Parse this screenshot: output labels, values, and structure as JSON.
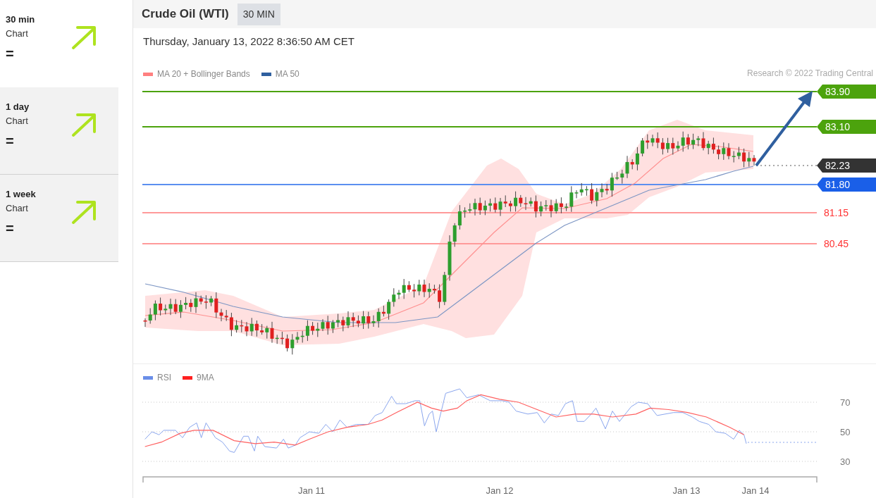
{
  "sidebar": {
    "items": [
      {
        "timeframe": "30 min",
        "label": "Chart",
        "trend_text": "=",
        "selected": true
      },
      {
        "timeframe": "1 day",
        "label": "Chart",
        "trend_text": "=",
        "selected": false
      },
      {
        "timeframe": "1 week",
        "label": "Chart",
        "trend_text": "=",
        "selected": false
      }
    ]
  },
  "header": {
    "title": "Crude Oil (WTI)",
    "timeframe_badge": "30 MIN"
  },
  "timestamp": "Thursday, January 13, 2022 8:36:50 AM CET",
  "price_chart": {
    "legend": [
      {
        "label": "MA 20 + Bollinger Bands",
        "color": "#ff8080"
      },
      {
        "label": "MA 50",
        "color": "#2f5f9f"
      }
    ],
    "credit": "Research © 2022 Trading Central",
    "levels": [
      {
        "value": "83.90",
        "kind": "resistance"
      },
      {
        "value": "83.10",
        "kind": "resistance"
      },
      {
        "value": "82.23",
        "kind": "current"
      },
      {
        "value": "81.80",
        "kind": "pivot"
      },
      {
        "value": "81.15",
        "kind": "support"
      },
      {
        "value": "80.45",
        "kind": "support"
      }
    ]
  },
  "rsi_chart": {
    "legend": [
      {
        "label": "RSI",
        "color": "#6a8ee8"
      },
      {
        "label": "9MA",
        "color": "#ff2020"
      }
    ],
    "yticks": [
      "70",
      "50",
      "30"
    ],
    "dates": [
      "Jan 11",
      "Jan 12",
      "Jan 13",
      "Jan 14"
    ]
  }
}
